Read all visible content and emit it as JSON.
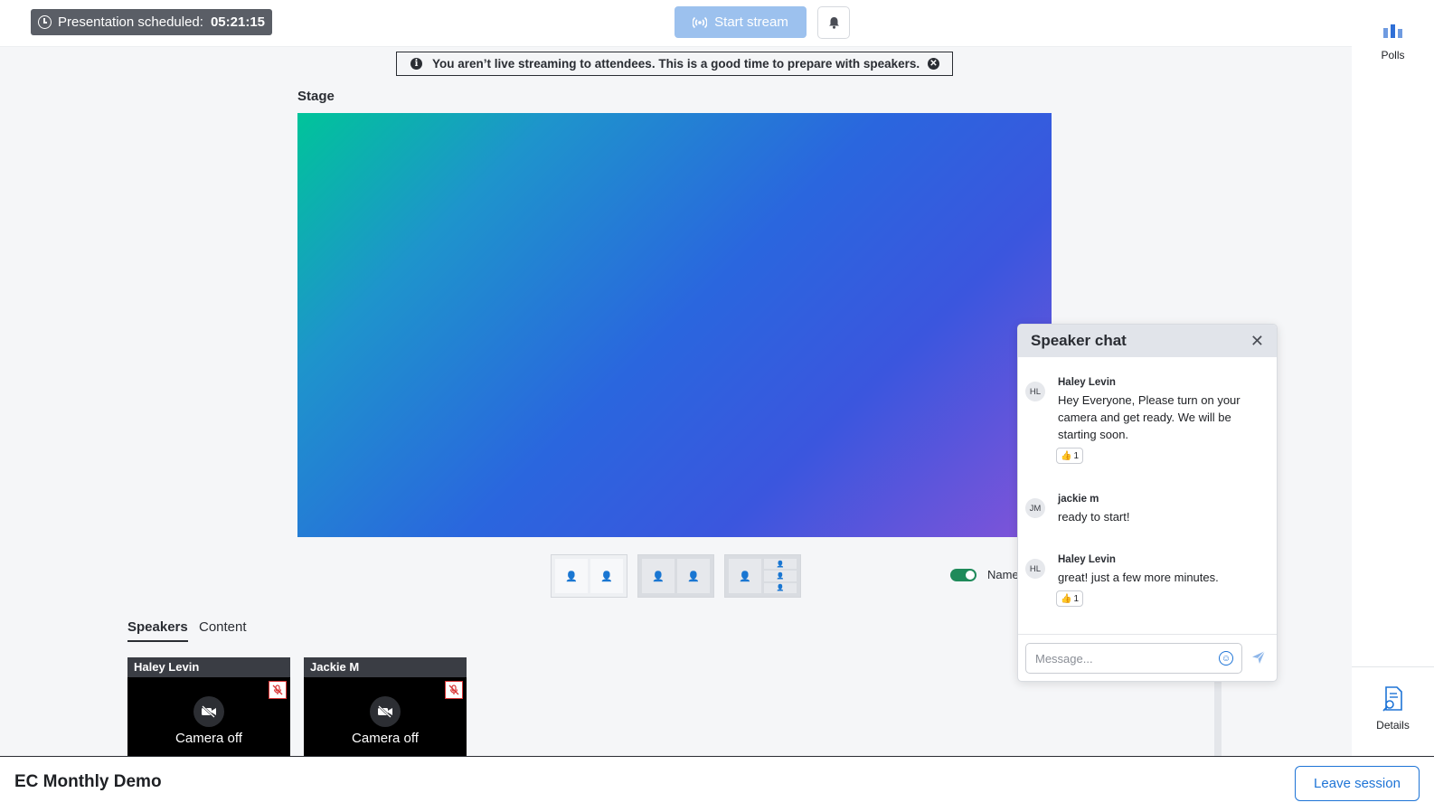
{
  "topbar": {
    "schedule_label": "Presentation scheduled:",
    "schedule_timer": "05:21:15",
    "start_stream_label": "Start stream"
  },
  "banner": {
    "message": "You aren’t live streaming to attendees. This is a good time to prepare with speakers."
  },
  "stage": {
    "label": "Stage",
    "names_toggle_label": "Names",
    "names_toggle_on": true
  },
  "rail": {
    "polls_label": "Polls",
    "details_label": "Details"
  },
  "tabs": [
    {
      "label": "Speakers",
      "active": true
    },
    {
      "label": "Content",
      "active": false
    }
  ],
  "speakers": [
    {
      "name": "Haley Levin",
      "status": "Camera off"
    },
    {
      "name": "Jackie M",
      "status": "Camera off"
    }
  ],
  "chat": {
    "title": "Speaker chat",
    "messages": [
      {
        "initials": "HL",
        "author": "Haley Levin",
        "text": "Hey Everyone, Please turn on your camera and get ready. We will be starting soon.",
        "reaction_count": "1"
      },
      {
        "initials": "JM",
        "author": "jackie m",
        "text": "ready to start!"
      },
      {
        "initials": "HL",
        "author": "Haley Levin",
        "text": "great! just a few more minutes.",
        "reaction_count": "1"
      }
    ],
    "input_placeholder": "Message..."
  },
  "footer": {
    "session_title": "EC Monthly Demo",
    "leave_label": "Leave session"
  },
  "colors": {
    "accent": "#1e74d6",
    "start_stream_disabled": "#9cc1ee",
    "toggle_on": "#1f8a5a"
  }
}
